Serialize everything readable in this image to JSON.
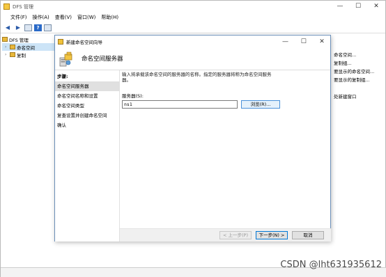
{
  "main_window": {
    "title": "DFS 管理",
    "minimize": "—",
    "maximize": "☐",
    "close": "✕",
    "menu": [
      "文件(F)",
      "操作(A)",
      "查看(V)",
      "窗口(W)",
      "帮助(H)"
    ],
    "tree": {
      "root": "DFS 管理",
      "items": [
        "命名空间",
        "复制"
      ]
    },
    "actions": [
      "命名空间...",
      "复制组...",
      "要显示的命名空间...",
      "要显示的复制组...",
      "",
      "处新建窗口"
    ],
    "watermark": "CSDN @lht631935612"
  },
  "dialog": {
    "title": "新建命名空间向导",
    "minimize": "—",
    "maximize": "☐",
    "close": "✕",
    "header": "命名空间服务器",
    "steps_heading": "步骤:",
    "steps": [
      "命名空间服务器",
      "命名空间名称和设置",
      "命名空间类型",
      "复查设置并创建命名空间",
      "确认"
    ],
    "active_step": 0,
    "description": "输入将承载该命名空间的服务器的名称。指定的服务器将称为命名空间服务器。",
    "server_label": "服务器(S):",
    "server_value": "ns1",
    "browse_label": "浏览(R)...",
    "buttons": {
      "prev": "< 上一步(P)",
      "next": "下一步(N) >",
      "cancel": "取消"
    }
  }
}
